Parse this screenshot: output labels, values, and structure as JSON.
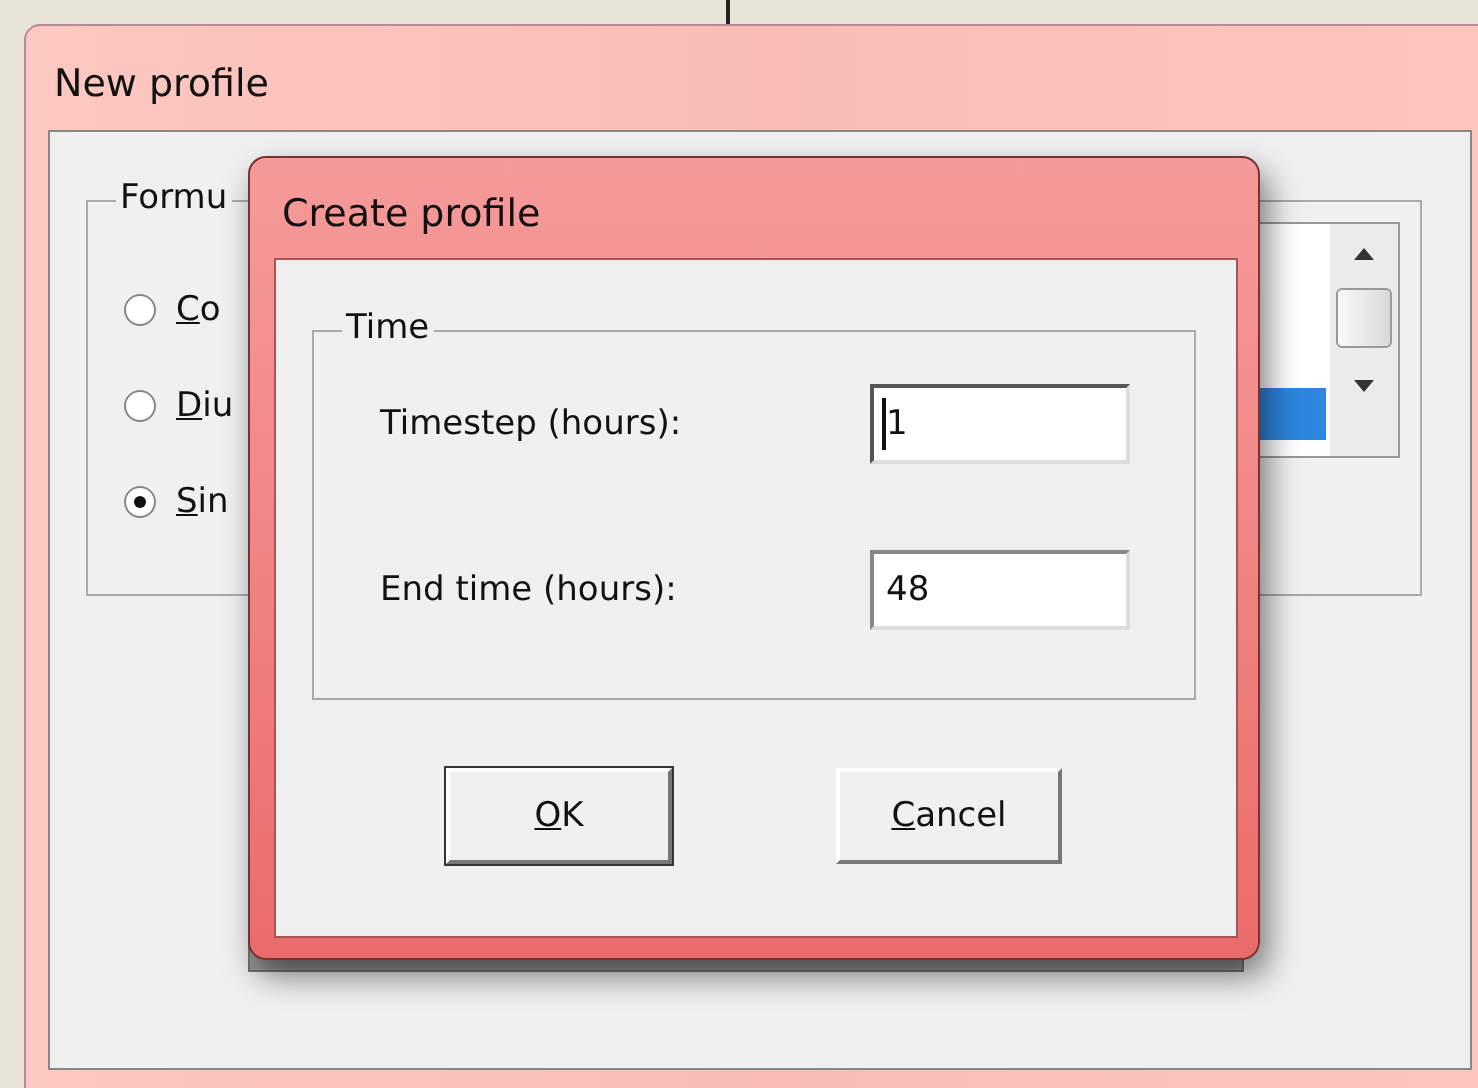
{
  "window": {
    "title": "New profile"
  },
  "formula_group": {
    "label": "Formu",
    "options": [
      {
        "label": "Co",
        "selected": false
      },
      {
        "label": "Diu",
        "selected": false
      },
      {
        "label": "Sin",
        "selected": true
      }
    ]
  },
  "dialog": {
    "title": "Create profile",
    "group": {
      "label": "Time",
      "fields": [
        {
          "label": "Timestep (hours):",
          "value": "1",
          "focused": true
        },
        {
          "label": "End time (hours):",
          "value": "48",
          "focused": false
        }
      ]
    },
    "buttons": [
      {
        "label": "OK",
        "default": true
      },
      {
        "label": "Cancel",
        "default": false
      }
    ]
  }
}
